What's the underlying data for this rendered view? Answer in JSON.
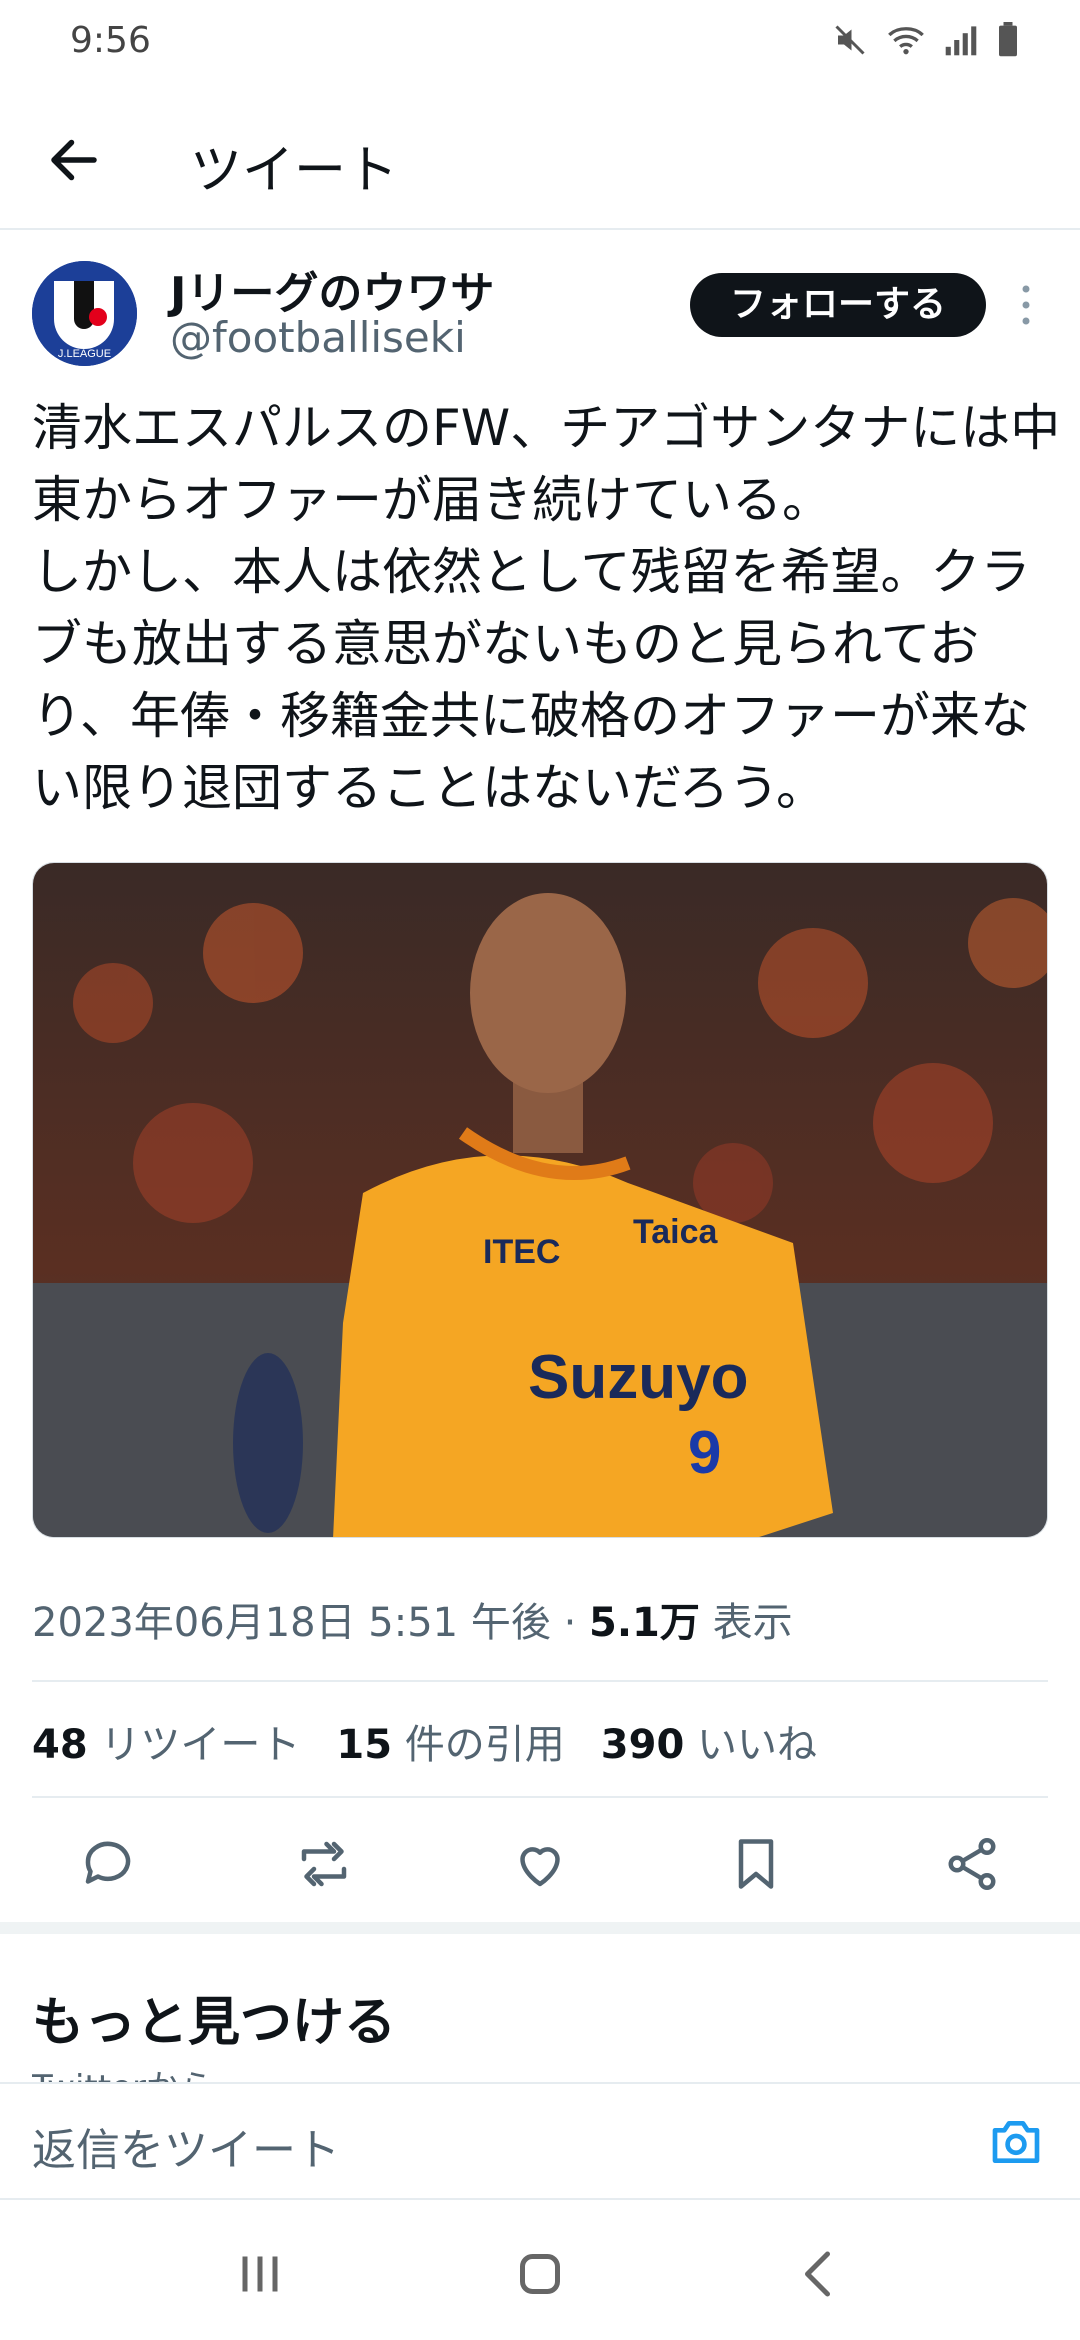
{
  "status_bar": {
    "time": "9:56",
    "icons": [
      "mute-icon",
      "wifi-icon",
      "signal-icon",
      "battery-icon"
    ]
  },
  "header": {
    "title": "ツイート"
  },
  "tweet": {
    "author_name": "Jリーグのウワサ",
    "author_handle": "@footballiseki",
    "avatar_text": "J.LEAGUE",
    "follow_label": "フォローする",
    "text": "清水エスパルスのFW、チアゴサンタナには中東からオファーが届き続けている。\nしかし、本人は依然として残留を希望。クラブも放出する意思がないものと見られており、年俸・移籍金共に破格のオファーが来ない限り退団することはないだろう。",
    "image_texts": {
      "sponsor_top_left": "ITEC",
      "sponsor_top_right": "Taica",
      "sponsor_main": "Suzuyo",
      "number": "9"
    },
    "timestamp": "2023年06月18日 5:51 午後",
    "separator": "·",
    "views_count": "5.1万",
    "views_label": "表示",
    "stats": {
      "retweets_count": "48",
      "retweets_label": "リツイート",
      "quotes_count": "15",
      "quotes_label": "件の引用",
      "likes_count": "390",
      "likes_label": "いいね"
    },
    "actions": [
      "reply-icon",
      "retweet-icon",
      "like-icon",
      "bookmark-icon",
      "share-icon"
    ]
  },
  "discover": {
    "title": "もっと見つける",
    "subtitle": "Twitterから"
  },
  "reply_bar": {
    "placeholder": "返信をツイート"
  },
  "colors": {
    "follow_bg": "#0f1419",
    "camera": "#1d9bf0",
    "secondary_text": "#536471",
    "jersey": "#f5a623"
  }
}
